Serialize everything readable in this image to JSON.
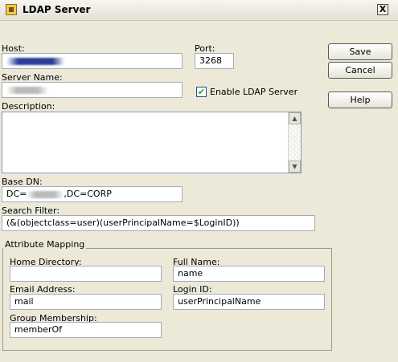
{
  "window": {
    "title": "LDAP Server",
    "close_glyph": "X"
  },
  "labels": {
    "host": "Host:",
    "port": "Port:",
    "server_name": "Server Name:",
    "enable": "Enable LDAP Server",
    "description": "Description:",
    "base_dn": "Base DN:",
    "search_filter": "Search Filter:",
    "attribute_mapping": "Attribute Mapping",
    "home_directory": "Home Directory:",
    "full_name": "Full Name:",
    "email_address": "Email Address:",
    "login_id": "Login ID:",
    "group_membership": "Group Membership:"
  },
  "values": {
    "port": "3268",
    "enable_checked": true,
    "checkmark": "✔",
    "description": "",
    "base_dn_prefix": "DC=",
    "base_dn_suffix": ",DC=CORP",
    "search_filter": "(&(objectclass=user)(userPrincipalName=$LoginID))",
    "home_directory": "",
    "full_name": "name",
    "email_address": "mail",
    "login_id": "userPrincipalName",
    "group_membership": "memberOf"
  },
  "buttons": {
    "save": "Save",
    "cancel": "Cancel",
    "help": "Help"
  },
  "icons": {
    "scroll_up": "▲",
    "scroll_down": "▼"
  }
}
